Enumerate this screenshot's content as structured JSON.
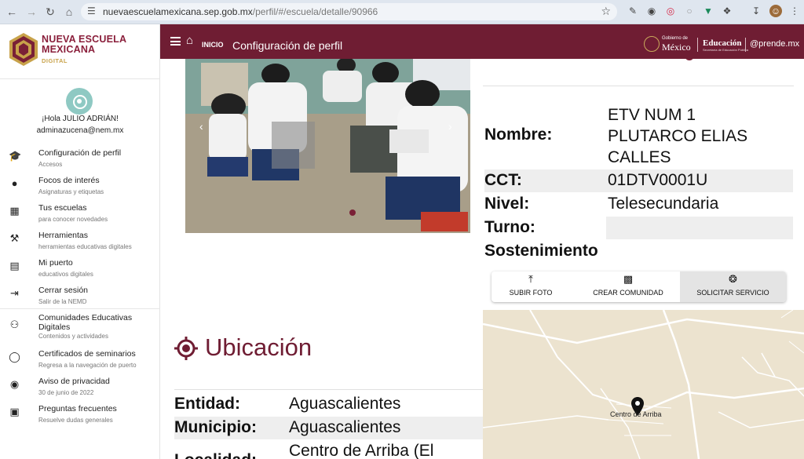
{
  "browser": {
    "url_host": "nuevaescuelamexicana.sep.gob.mx",
    "url_path": "/perfil/#/escuela/detalle/90966"
  },
  "logo": {
    "line1": "NUEVA ESCUELA",
    "line2": "MEXICANA",
    "line3": "DIGITAL"
  },
  "user": {
    "greeting": "¡Hola JULIO ADRIÁN!",
    "email": "adminazucena@nem.mx"
  },
  "sidebar": {
    "items": [
      {
        "title": "Configuración de perfil",
        "subtitle": "Accesos",
        "icon": "graduation-cap-icon"
      },
      {
        "title": "Focos de interés",
        "subtitle": "Asignaturas y etiquetas",
        "icon": "lightbulb-icon"
      },
      {
        "title": "Tus escuelas",
        "subtitle": "para conocer novedades",
        "icon": "building-icon"
      },
      {
        "title": "Herramientas",
        "subtitle": "herramientas educativas digitales",
        "icon": "tools-icon"
      },
      {
        "title": "Mi puerto",
        "subtitle": "educativos digitales",
        "icon": "library-icon"
      },
      {
        "title": "Cerrar sesión",
        "subtitle": "Salir de la NEMD",
        "icon": "logout-icon"
      },
      {
        "title": "Comunidades Educativas Digitales",
        "subtitle": "Contenidos y actividades",
        "icon": "groups-icon"
      },
      {
        "title": "Certificados de seminarios",
        "subtitle": "Regresa a la navegación de puerto",
        "icon": "award-icon"
      },
      {
        "title": "Aviso de privacidad",
        "subtitle": "30 de junio de 2022",
        "icon": "privacy-shield-icon"
      },
      {
        "title": "Preguntas frecuentes",
        "subtitle": "Resuelve dudas generales",
        "icon": "faq-icon"
      }
    ]
  },
  "header": {
    "inicio": "INICIO",
    "title": "Configuración de perfil",
    "gob_small": "Gobierno de",
    "gob_big": "México",
    "educacion": "Educación",
    "educacion_sub": "Secretaría de Educación Pública",
    "aprende": "@prende.mx"
  },
  "school": {
    "nombre_label": "Nombre:",
    "nombre_value": "ETV NUM 1 PLUTARCO ELIAS CALLES",
    "cct_label": "CCT:",
    "cct_value": "01DTV0001U",
    "nivel_label": "Nivel:",
    "nivel_value": "Telesecundaria",
    "turno_label": "Turno:",
    "turno_value": "",
    "sostenimiento_label": "Sostenimiento",
    "sostenimiento_value": ""
  },
  "actions": {
    "upload": "SUBIR FOTO",
    "community": "CREAR COMUNIDAD",
    "service": "SOLICITAR SERVICIO"
  },
  "location": {
    "title": "Ubicación",
    "entidad_label": "Entidad:",
    "entidad_value": "Aguascalientes",
    "municipio_label": "Municipio:",
    "municipio_value": "Aguascalientes",
    "localidad_label": "Localidad:",
    "localidad_value": "Centro de Arriba (El"
  },
  "map": {
    "place": "Centro de Arriba"
  },
  "colors": {
    "brand": "#6f1d33",
    "map_bg": "#ece3cf"
  }
}
